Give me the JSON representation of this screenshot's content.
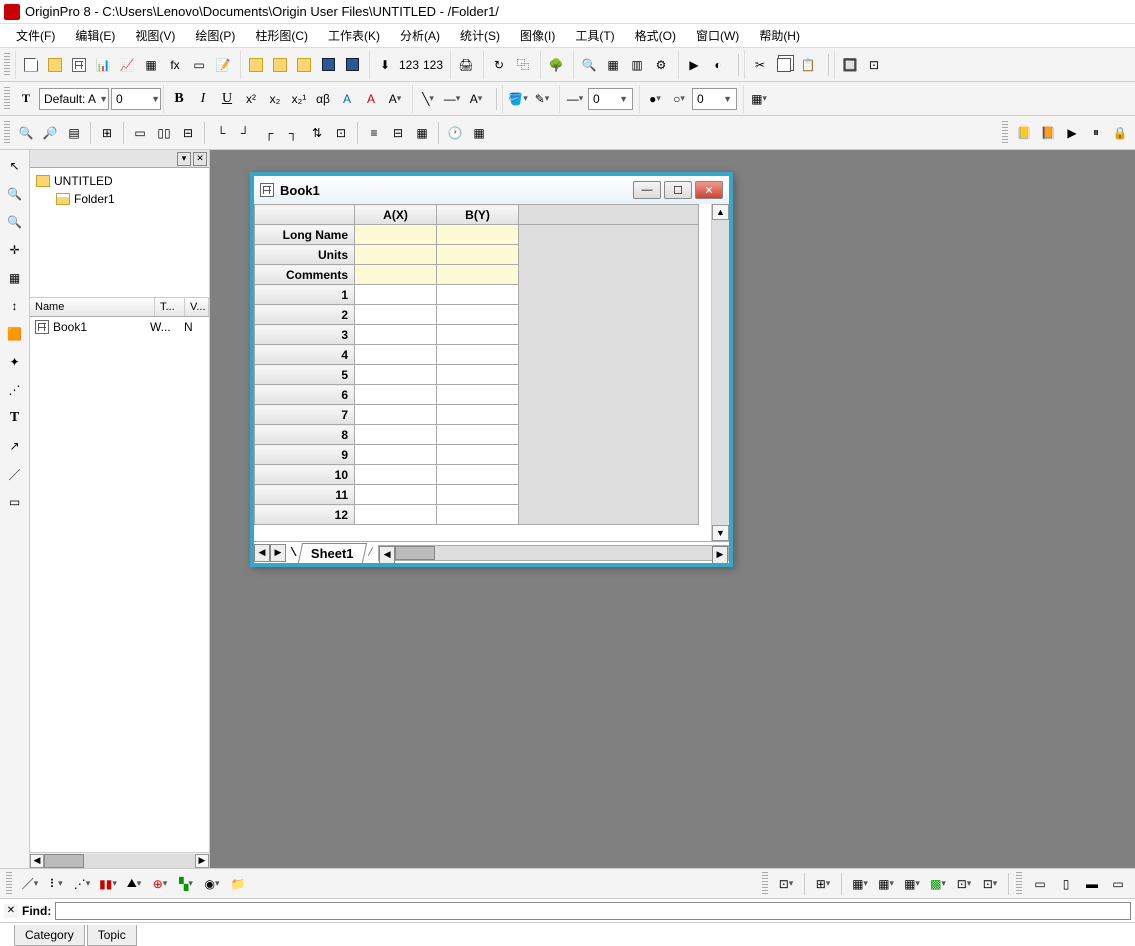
{
  "titlebar": {
    "title": "OriginPro 8 - C:\\Users\\Lenovo\\Documents\\Origin User Files\\UNTITLED - /Folder1/"
  },
  "menu": [
    "文件(F)",
    "编辑(E)",
    "视图(V)",
    "绘图(P)",
    "柱形图(C)",
    "工作表(K)",
    "分析(A)",
    "统计(S)",
    "图像(I)",
    "工具(T)",
    "格式(O)",
    "窗口(W)",
    "帮助(H)"
  ],
  "format": {
    "font_label": "Default: A",
    "size": "0",
    "bold": "B",
    "italic": "I",
    "underline": "U",
    "sup": "x²",
    "sub": "x₂",
    "subsup": "x₂¹",
    "greek": "αβ",
    "A1": "A",
    "A2": "A",
    "A3": "A",
    "lineWidth": "0",
    "symbolSize": "0"
  },
  "project": {
    "tree": {
      "root": "UNTITLED",
      "child": "Folder1"
    },
    "listCols": {
      "name": "Name",
      "type": "T...",
      "view": "V..."
    },
    "items": [
      {
        "name": "Book1",
        "type": "W...",
        "view": "N"
      }
    ]
  },
  "workbook": {
    "title": "Book1",
    "cols": [
      "A(X)",
      "B(Y)"
    ],
    "metaRows": [
      "Long Name",
      "Units",
      "Comments"
    ],
    "rows": [
      "1",
      "2",
      "3",
      "4",
      "5",
      "6",
      "7",
      "8",
      "9",
      "10",
      "11",
      "12"
    ],
    "sheet": "Sheet1"
  },
  "find": {
    "label": "Find:",
    "value": ""
  },
  "bottomTabs": [
    "Category",
    "Topic"
  ]
}
